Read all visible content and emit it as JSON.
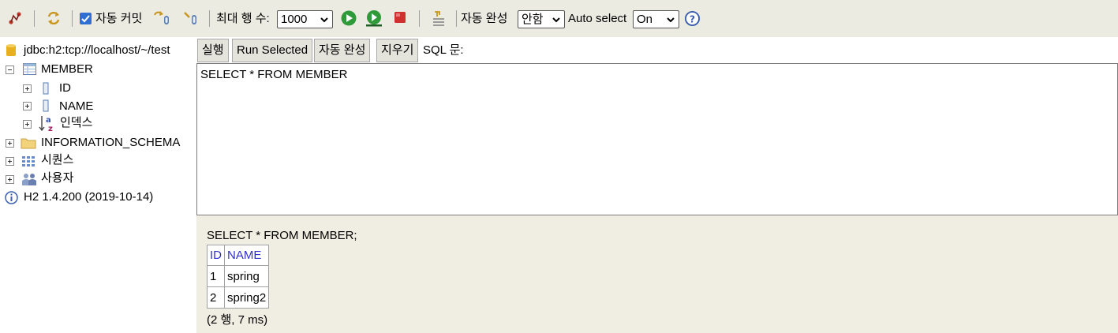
{
  "toolbar": {
    "autocommit_label": "자동 커밋",
    "autocommit_checked": true,
    "maxrows_label": "최대 행 수:",
    "maxrows_value": "1000",
    "autocomplete_label": "자동 완성",
    "autocomplete_value": "안함",
    "autoselect_label": "Auto select",
    "autoselect_value": "On",
    "icons": [
      "disconnect-icon",
      "refresh-icon",
      "rollback-icon",
      "commit-icon",
      "run-icon",
      "run-selected-icon",
      "stop-icon",
      "history-icon",
      "help-icon"
    ]
  },
  "tree": {
    "connection": "jdbc:h2:tcp://localhost/~/test",
    "table": "MEMBER",
    "columns": [
      "ID",
      "NAME"
    ],
    "indexes": "인덱스",
    "schema": "INFORMATION_SCHEMA",
    "sequences": "시퀀스",
    "users": "사용자",
    "version": "H2 1.4.200 (2019-10-14)"
  },
  "buttons": {
    "execute": "실행",
    "run_selected": "Run Selected",
    "autocomplete": "자동 완성",
    "clear": "지우기",
    "sql_label": "SQL 문:"
  },
  "editor": {
    "text": "SELECT * FROM MEMBER"
  },
  "result": {
    "query": "SELECT * FROM MEMBER;",
    "headers": [
      "ID",
      "NAME"
    ],
    "rows": [
      [
        "1",
        "spring"
      ],
      [
        "2",
        "spring2"
      ]
    ],
    "footer": "(2 행, 7 ms)"
  }
}
